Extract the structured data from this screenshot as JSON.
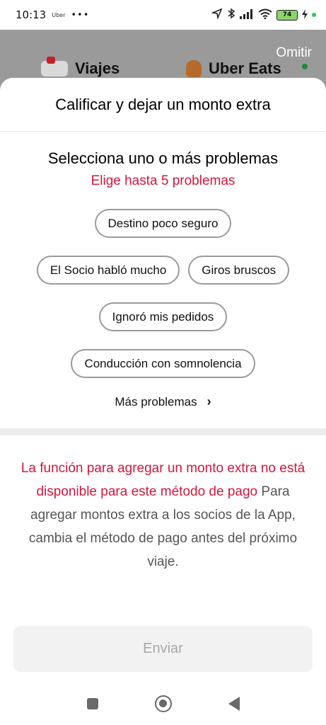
{
  "status_bar": {
    "time": "10:13",
    "app_label": "Uber",
    "dots": "•••",
    "battery": "74"
  },
  "background_app": {
    "skip_label": "Omitir",
    "tabs": [
      {
        "label": "Viajes",
        "icon": "car-icon"
      },
      {
        "label": "Uber Eats",
        "icon": "gingerbread-icon"
      }
    ]
  },
  "sheet": {
    "title": "Calificar y dejar un monto extra",
    "problems": {
      "heading": "Selecciona uno o más problemas",
      "subheading": "Elige hasta 5 problemas",
      "chips": [
        "Destino poco seguro",
        "El Socio habló mucho",
        "Giros bruscos",
        "Ignoró mis pedidos",
        "Conducción con somnolencia"
      ],
      "more_label": "Más problemas",
      "more_icon": "chevron-right-icon"
    },
    "notice": {
      "warning": "La función para agregar un monto extra no está disponible para este método de pago",
      "info": "Para agregar montos extra a los socios de la App, cambia el método de pago antes del próximo viaje."
    },
    "submit_label": "Enviar"
  },
  "colors": {
    "accent_red": "#d1173d",
    "overlay_gray": "#9a9a9a",
    "disabled_button_bg": "#f2f2f2",
    "disabled_button_text": "#a8a8a8"
  }
}
